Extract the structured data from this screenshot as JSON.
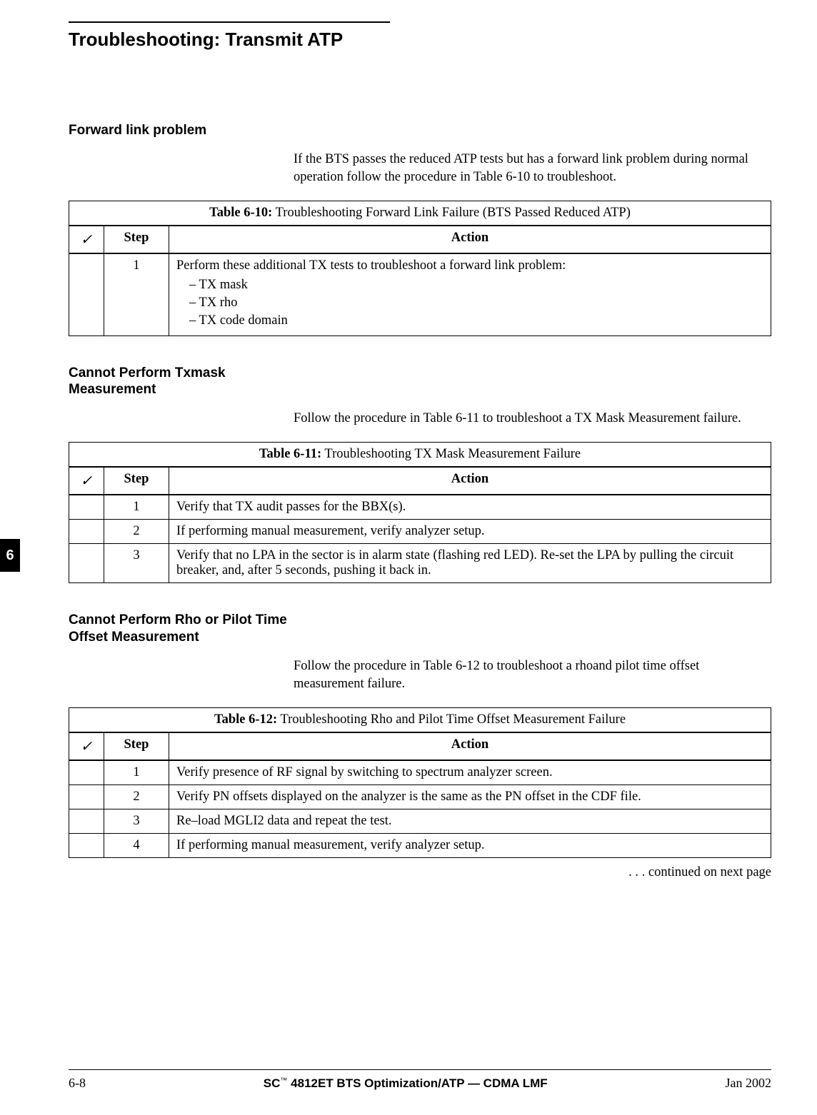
{
  "page_title": "Troubleshooting: Transmit ATP",
  "side_tab": "6",
  "sections": {
    "s1": {
      "heading": "Forward link problem",
      "para": "If the BTS passes the reduced ATP tests but has a forward link problem during normal operation follow the procedure in Table 6-10 to troubleshoot."
    },
    "s2": {
      "heading": "Cannot Perform Txmask Measurement",
      "para": "Follow the procedure in Table 6-11 to troubleshoot a TX Mask Measurement failure."
    },
    "s3": {
      "heading": "Cannot Perform Rho or Pilot Time Offset Measurement",
      "para": "Follow the procedure in Table 6-12 to troubleshoot a rhoand pilot time offset measurement failure."
    }
  },
  "col_headers": {
    "step": "Step",
    "action": "Action"
  },
  "table_610": {
    "label": "Table 6-10:",
    "caption": " Troubleshooting Forward Link Failure (BTS Passed Reduced ATP)",
    "rows": [
      {
        "step": "1",
        "action_lead": "Perform these additional TX tests to troubleshoot a forward link problem:",
        "items": [
          "TX mask",
          "TX  rho",
          "TX code domain"
        ]
      }
    ]
  },
  "table_611": {
    "label": "Table 6-11:",
    "caption": " Troubleshooting TX Mask Measurement Failure",
    "rows": [
      {
        "step": "1",
        "action": "Verify that TX audit passes for the BBX(s)."
      },
      {
        "step": "2",
        "action": "If performing manual measurement, verify analyzer setup."
      },
      {
        "step": "3",
        "action": "Verify that no LPA in the sector is in alarm state (flashing red LED). Re-set the LPA by pulling the circuit breaker, and, after 5 seconds, pushing it back in."
      }
    ]
  },
  "table_612": {
    "label": "Table 6-12:",
    "caption": " Troubleshooting Rho and Pilot Time Offset Measurement Failure",
    "rows": [
      {
        "step": "1",
        "action": "Verify presence of RF signal by switching to spectrum analyzer screen."
      },
      {
        "step": "2",
        "action": "Verify PN offsets displayed on the analyzer is the same as the PN offset in the CDF file."
      },
      {
        "step": "3",
        "action": "Re–load MGLI2 data and repeat the test."
      },
      {
        "step": "4",
        "action": "If performing manual measurement, verify analyzer setup."
      }
    ]
  },
  "continued_text": ". . . continued on next page",
  "footer": {
    "page": "6-8",
    "center_pre": "SC",
    "center_tm": "™",
    "center_post": "4812ET BTS Optimization/ATP — CDMA LMF",
    "date": "Jan 2002"
  }
}
